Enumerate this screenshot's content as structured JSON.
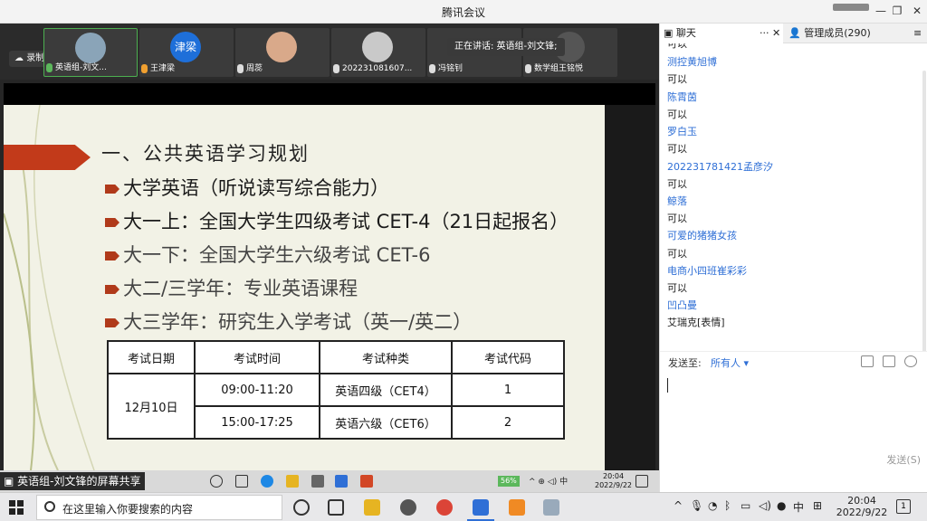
{
  "window": {
    "title": "腾讯会议"
  },
  "meeting": {
    "recording_label": "录制中",
    "speaking_label": "正在讲话: 英语组-刘文锋;",
    "participants": [
      {
        "name": "英语组-刘文..."
      },
      {
        "name": "王津梁",
        "avatar_text": "津梁"
      },
      {
        "name": "周蕊"
      },
      {
        "name": "202231081607..."
      },
      {
        "name": "冯铭钊"
      },
      {
        "name": "数学组王铭悦"
      }
    ],
    "share_label": "英语组-刘文锋的屏幕共享",
    "share_tray": {
      "battery": "56%",
      "time": "20:04",
      "date": "2022/9/22"
    }
  },
  "slide": {
    "heading": "一、公共英语学习规划",
    "bullets": [
      "大学英语（听说读写综合能力）",
      "大一上：全国大学生四级考试 CET-4（21日起报名）",
      "大一下：全国大学生六级考试 CET-6",
      "大二/三学年：专业英语课程",
      "大三学年：研究生入学考试（英一/英二）"
    ],
    "table": {
      "headers": [
        "考试日期",
        "考试时间",
        "考试种类",
        "考试代码"
      ],
      "date": "12月10日",
      "rows": [
        {
          "time": "09:00-11:20",
          "kind": "英语四级（CET4）",
          "code": "1"
        },
        {
          "time": "15:00-17:25",
          "kind": "英语六级（CET6）",
          "code": "2"
        }
      ]
    }
  },
  "chat": {
    "tab_chat": "聊天",
    "tab_members": "管理成员(290)",
    "messages": [
      {
        "type": "text",
        "value": "可以"
      },
      {
        "type": "name",
        "value": "测控黄旭博"
      },
      {
        "type": "text",
        "value": "可以"
      },
      {
        "type": "name",
        "value": "陈霄茵"
      },
      {
        "type": "text",
        "value": "可以"
      },
      {
        "type": "name",
        "value": "罗白玉"
      },
      {
        "type": "text",
        "value": "可以"
      },
      {
        "type": "name",
        "value": "202231781421孟彦汐"
      },
      {
        "type": "text",
        "value": "可以"
      },
      {
        "type": "name",
        "value": "鲸落"
      },
      {
        "type": "text",
        "value": "可以"
      },
      {
        "type": "name",
        "value": "可爱的猪猪女孩"
      },
      {
        "type": "text",
        "value": "可以"
      },
      {
        "type": "name",
        "value": "电商小四班崔彩彩"
      },
      {
        "type": "text",
        "value": "可以"
      },
      {
        "type": "name",
        "value": "凹凸曼"
      },
      {
        "type": "text",
        "value": "艾瑞克[表情]"
      }
    ],
    "send_to_label": "发送至:",
    "send_to_value": "所有人",
    "send_button": "发送(S)"
  },
  "taskbar": {
    "search_placeholder": "在这里输入你要搜索的内容",
    "ime": "中",
    "time": "20:04",
    "date": "2022/9/22",
    "notification_count": "1"
  }
}
